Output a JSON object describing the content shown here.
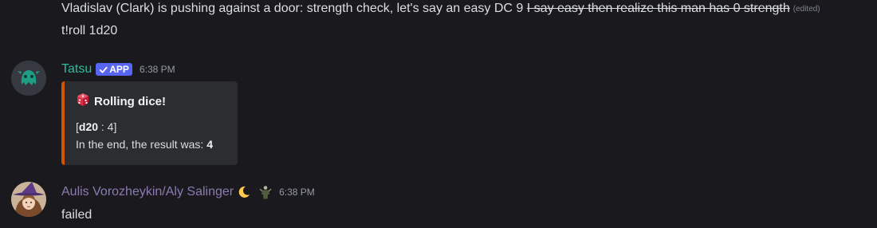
{
  "continuation": {
    "line1": {
      "text": "Vladislav (Clark) is pushing against a door: strength check, let's say an easy DC 9",
      "strike": "I say easy then realize this man has 0 strength",
      "edited": "(edited)"
    },
    "line2": {
      "text": "t!roll 1d20"
    }
  },
  "messages": [
    {
      "username": "Tatsu",
      "badge": "APP",
      "timestamp": "6:38 PM",
      "name_color": "#2dbd9c",
      "avatar_icon": "tatsu-avatar-icon",
      "embed": {
        "accent_color": "#d35400",
        "icon": "dice-icon",
        "title": "Rolling dice!",
        "roll_open": "[",
        "roll_die": "d20",
        "roll_rest": " : 4]",
        "result_label": "In the end, the result was:",
        "result_value": "4"
      }
    },
    {
      "username": "Aulis Vorozheykin/Aly Salinger",
      "timestamp": "6:38 PM",
      "name_color": "#8b7bb1",
      "avatar_icon": "witch-avatar-icon",
      "role_icons": [
        "crescent-moon-icon",
        "character-figure-icon"
      ],
      "body": "failed"
    }
  ],
  "colors": {
    "background": "#1a1a1e",
    "text": "#dbdee1",
    "badge": "#5865f2",
    "timestamp": "#949ba4"
  }
}
